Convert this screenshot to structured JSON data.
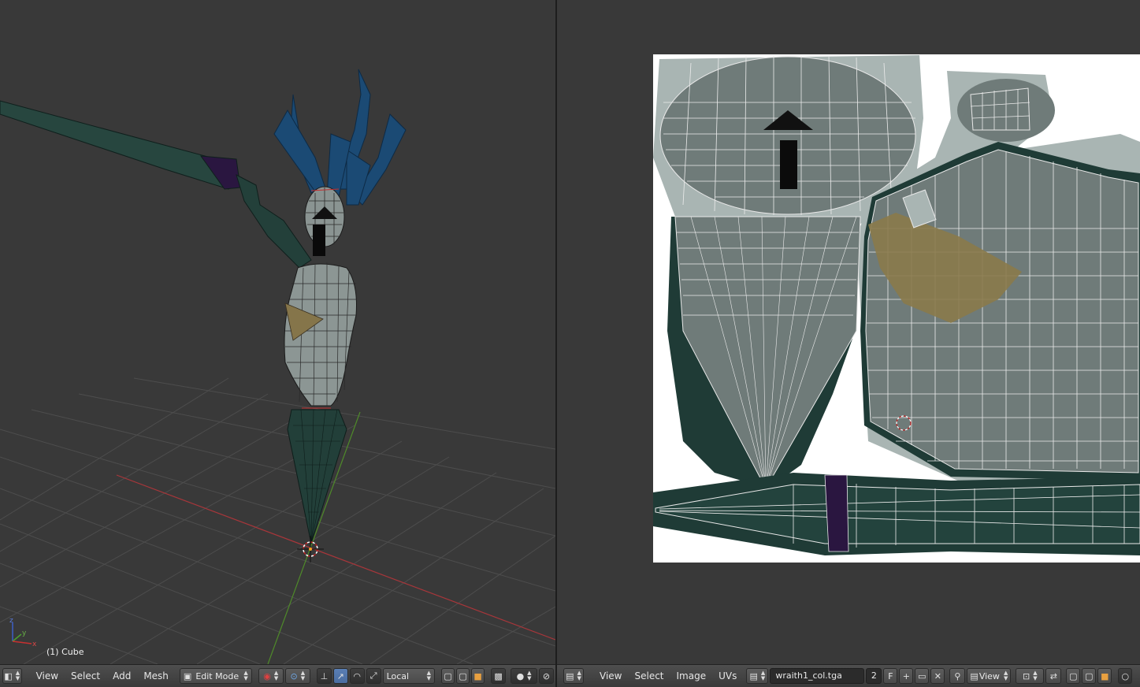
{
  "viewport3d": {
    "object_label": "(1) Cube",
    "axis_x": "x",
    "axis_y": "y",
    "axis_z": "z"
  },
  "header_3d": {
    "menus": [
      "View",
      "Select",
      "Add",
      "Mesh"
    ],
    "mode": "Edit Mode",
    "orientation": "Local"
  },
  "header_uv": {
    "menus": [
      "View",
      "Select",
      "Image",
      "UVs"
    ],
    "image_name": "wraith1_col.tga",
    "users": "2",
    "fake_user": "F",
    "view_mode": "View"
  },
  "colors": {
    "background": "#393939",
    "grid": "#4c4c4c",
    "x_axis": "#c0393b",
    "y_axis": "#5a9a2a",
    "mesh_gray": "#8a9492",
    "mesh_dark": "#1f3b36",
    "hair_blue": "#1c4a72",
    "patch_gold": "#8a7a4a",
    "uv_light": "#a9b5b3",
    "uv_mid": "#6f7b79"
  }
}
